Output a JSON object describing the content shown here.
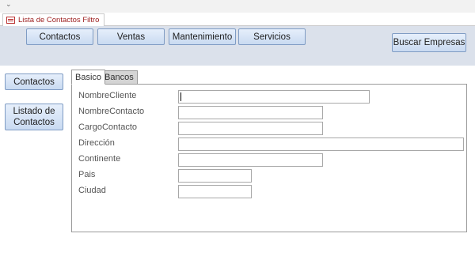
{
  "document_tab": {
    "title": "Lista de Contactos Filtro"
  },
  "nav": {
    "buttons": [
      "Contactos",
      "Ventas",
      "Mantenimiento",
      "Servicios"
    ],
    "search_button": "Buscar Empresas"
  },
  "side": {
    "contactos": "Contactos",
    "listado": "Listado de Contactos"
  },
  "form_tabs": [
    "Basico",
    "Bancos"
  ],
  "fields": [
    {
      "label": "NombreCliente",
      "value": ""
    },
    {
      "label": "NombreContacto",
      "value": ""
    },
    {
      "label": "CargoContacto",
      "value": ""
    },
    {
      "label": "Dirección",
      "value": ""
    },
    {
      "label": "Continente",
      "value": ""
    },
    {
      "label": "Pais",
      "value": ""
    },
    {
      "label": "Ciudad",
      "value": ""
    }
  ]
}
